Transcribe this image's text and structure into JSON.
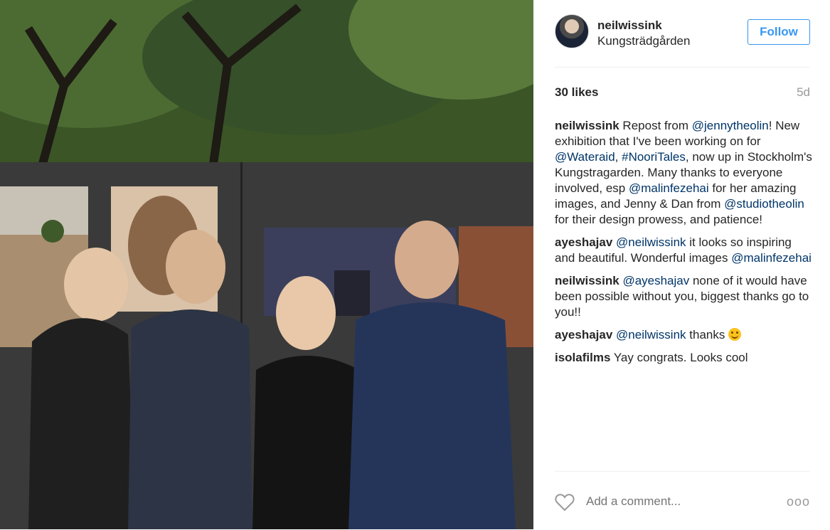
{
  "post": {
    "image_alt": "",
    "username": "neilwissink",
    "location": "Kungsträdgården",
    "follow_label": "Follow",
    "likes": "30 likes",
    "age": "5d"
  },
  "comments": [
    {
      "user": "neilwissink",
      "parts": [
        {
          "t": " Repost from "
        },
        {
          "m": "@jennytheolin"
        },
        {
          "t": "! New exhibition that I've been working on for "
        },
        {
          "m": "@Wateraid"
        },
        {
          "t": ", "
        },
        {
          "m": "#NooriTales"
        },
        {
          "t": ", now up in Stockholm's Kungstragarden. Many thanks to everyone involved, esp "
        },
        {
          "m": "@malinfezehai"
        },
        {
          "t": " for her amazing images, and Jenny & Dan from "
        },
        {
          "m": "@studiotheolin"
        },
        {
          "t": " for their design prowess, and patience!"
        }
      ]
    },
    {
      "user": "ayeshajav",
      "parts": [
        {
          "t": " "
        },
        {
          "m": "@neilwissink"
        },
        {
          "t": " it looks so inspiring and beautiful. Wonderful images "
        },
        {
          "m": "@malinfezehai"
        }
      ]
    },
    {
      "user": "neilwissink",
      "parts": [
        {
          "t": " "
        },
        {
          "m": "@ayeshajav"
        },
        {
          "t": " none of it would have been possible without you, biggest thanks go to you!!"
        }
      ]
    },
    {
      "user": "ayeshajav",
      "parts": [
        {
          "t": " "
        },
        {
          "m": "@neilwissink"
        },
        {
          "t": " thanks "
        },
        {
          "e": "smiling-face-emoji"
        }
      ]
    },
    {
      "user": "isolafilms",
      "parts": [
        {
          "t": " Yay congrats. Looks cool"
        }
      ]
    }
  ],
  "footer": {
    "comment_placeholder": "Add a comment...",
    "more_label": "ooo",
    "like_icon": "heart-icon"
  },
  "colors": {
    "accent": "#3897f0",
    "mention": "#003569",
    "muted": "#999999",
    "text": "#262626"
  }
}
